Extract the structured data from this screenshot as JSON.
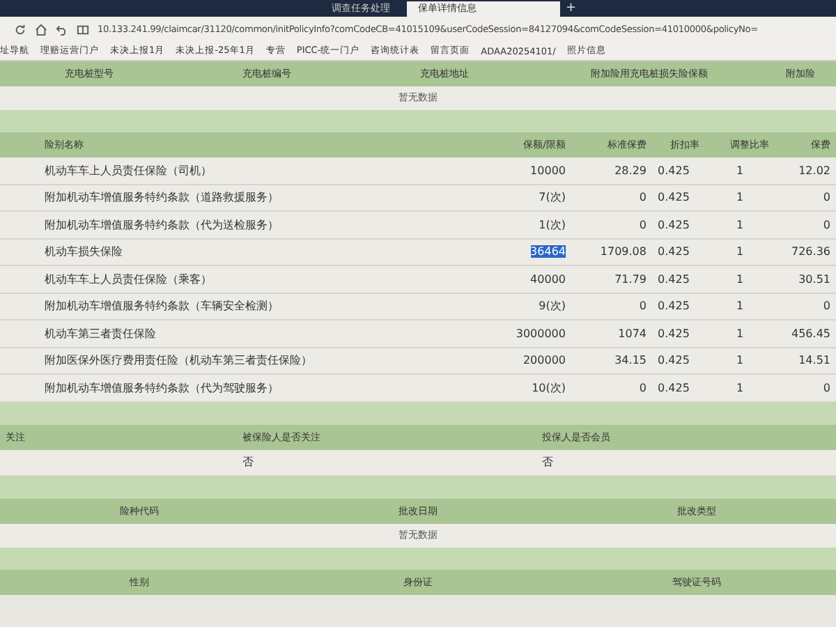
{
  "browser": {
    "tabs": [
      {
        "label": "调查任务处理",
        "selected": false
      },
      {
        "label": "保单详情信息",
        "selected": true
      }
    ],
    "new_tab": "+",
    "url": "10.133.241.99/claimcar/31120/common/initPolicyInfo?comCodeCB=41015109&userCodeSession=84127094&comCodeSession=41010000&policyNo=",
    "bookmarks": [
      "址导航",
      "理赔运营门户",
      "未决上报1月",
      "未决上报-25年1月",
      "专营",
      "PICC-统一门户",
      "咨询统计表",
      "留言页面",
      "ADAA20254101/",
      "照片信息"
    ]
  },
  "charger_table": {
    "columns": [
      "充电桩型号",
      "充电桩编号",
      "充电桩地址",
      "附加险用充电桩损失险保额",
      "附加险"
    ],
    "empty": "暂无数据"
  },
  "coverage_table": {
    "columns": [
      "险别名称",
      "保额/限额",
      "标准保费",
      "折扣率",
      "调整比率",
      "保费"
    ],
    "rows": [
      {
        "name": "机动车车上人员责任保险（司机）",
        "amount": "10000",
        "standard": "28.29",
        "discount": "0.425",
        "ratio": "1",
        "premium": "12.02",
        "selected": false
      },
      {
        "name": "附加机动车增值服务特约条款（道路救援服务）",
        "amount": "7(次)",
        "standard": "0",
        "discount": "0.425",
        "ratio": "1",
        "premium": "0",
        "selected": false
      },
      {
        "name": "附加机动车增值服务特约条款（代为送检服务）",
        "amount": "1(次)",
        "standard": "0",
        "discount": "0.425",
        "ratio": "1",
        "premium": "0",
        "selected": false
      },
      {
        "name": "机动车损失保险",
        "amount": "36464",
        "standard": "1709.08",
        "discount": "0.425",
        "ratio": "1",
        "premium": "726.36",
        "selected": true
      },
      {
        "name": "机动车车上人员责任保险（乘客）",
        "amount": "40000",
        "standard": "71.79",
        "discount": "0.425",
        "ratio": "1",
        "premium": "30.51",
        "selected": false
      },
      {
        "name": "附加机动车增值服务特约条款（车辆安全检测）",
        "amount": "9(次)",
        "standard": "0",
        "discount": "0.425",
        "ratio": "1",
        "premium": "0",
        "selected": false
      },
      {
        "name": "机动车第三者责任保险",
        "amount": "3000000",
        "standard": "1074",
        "discount": "0.425",
        "ratio": "1",
        "premium": "456.45",
        "selected": false
      },
      {
        "name": "附加医保外医疗费用责任险（机动车第三者责任保险）",
        "amount": "200000",
        "standard": "34.15",
        "discount": "0.425",
        "ratio": "1",
        "premium": "14.51",
        "selected": false
      },
      {
        "name": "附加机动车增值服务特约条款（代为驾驶服务）",
        "amount": "10(次)",
        "standard": "0",
        "discount": "0.425",
        "ratio": "1",
        "premium": "0",
        "selected": false
      }
    ]
  },
  "attention_table": {
    "columns": [
      "关注",
      "被保险人是否关注",
      "投保人是否会员"
    ],
    "values": [
      "否",
      "否"
    ]
  },
  "endorse_table": {
    "columns": [
      "险种代码",
      "批改日期",
      "批改类型"
    ],
    "empty": "暂无数据"
  },
  "driver_table": {
    "columns": [
      "性别",
      "身份证",
      "驾驶证号码"
    ]
  }
}
